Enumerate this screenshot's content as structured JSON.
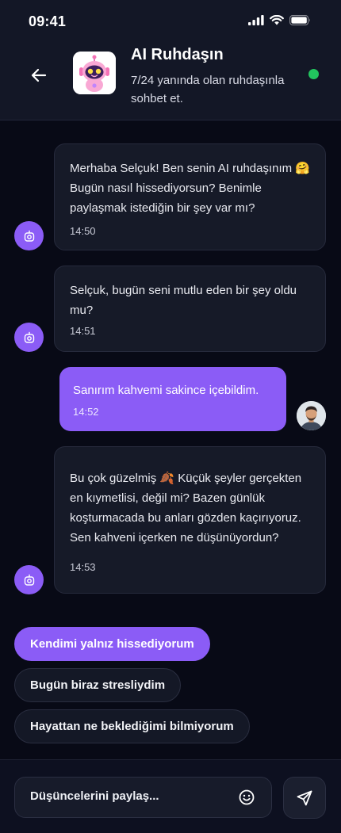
{
  "status_bar": {
    "time": "09:41"
  },
  "header": {
    "title": "AI Ruhdaşın",
    "subtitle": "7/24 yanında olan ruhdaşınla sohbet et.",
    "online_color": "#22c55e",
    "icons": {
      "back": "arrow-left-icon",
      "avatar": "robot-avatar-icon"
    }
  },
  "messages": [
    {
      "sender": "bot",
      "text": "Merhaba Selçuk! Ben senin AI ruhdaşınım 🤗 Bugün nasıl hissediyorsun? Benimle paylaşmak istediğin bir şey var mı?",
      "time": "14:50"
    },
    {
      "sender": "bot",
      "text": "Selçuk, bugün seni mutlu eden bir şey oldu mu?",
      "time": "14:51"
    },
    {
      "sender": "user",
      "text": "Sanırım kahvemi sakince içebildim.",
      "time": "14:52"
    },
    {
      "sender": "bot",
      "text": "Bu çok güzelmiş 🍂 Küçük şeyler gerçekten en kıymetlisi, değil mi? Bazen günlük koşturmacada bu anları gözden kaçırıyoruz. Sen kahveni içerken ne düşünüyordun?",
      "time": "14:53"
    }
  ],
  "quick_replies": [
    {
      "label": "Kendimi yalnız hissediyorum",
      "active": true
    },
    {
      "label": "Bugün biraz stresliydim",
      "active": false
    },
    {
      "label": "Hayattan ne beklediğimi bilmiyorum",
      "active": false
    }
  ],
  "composer": {
    "placeholder": "Düşüncelerini paylaş...",
    "icons": {
      "emoji": "smiley-icon",
      "send": "send-icon"
    }
  },
  "colors": {
    "accent": "#8b5cf6",
    "background": "#080a16",
    "header": "#131726"
  }
}
